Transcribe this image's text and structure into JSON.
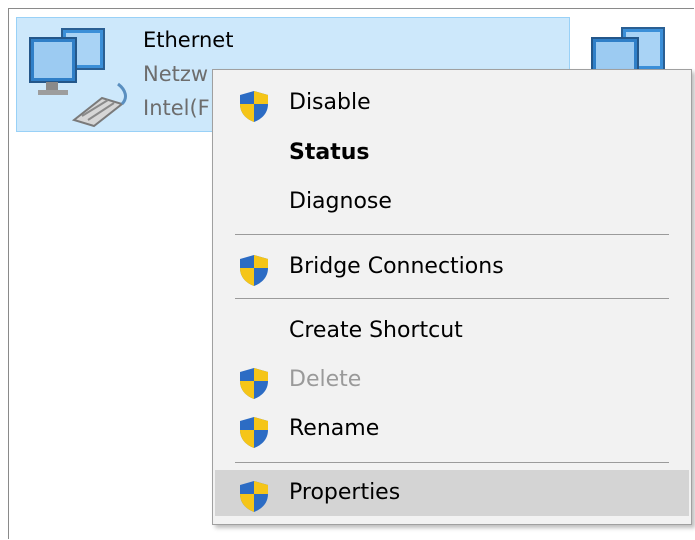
{
  "adapter": {
    "name": "Ethernet",
    "line2": "Netzw",
    "line3": "Intel(F"
  },
  "context_menu": {
    "items": [
      {
        "label": "Disable",
        "icon": "uac-shield-icon",
        "style": "normal"
      },
      {
        "label": "Status",
        "icon": "",
        "style": "bold"
      },
      {
        "label": "Diagnose",
        "icon": "",
        "style": "normal"
      },
      {
        "label": "Bridge Connections",
        "icon": "uac-shield-icon",
        "style": "normal"
      },
      {
        "label": "Create Shortcut",
        "icon": "",
        "style": "normal"
      },
      {
        "label": "Delete",
        "icon": "uac-shield-icon",
        "style": "disabled"
      },
      {
        "label": "Rename",
        "icon": "uac-shield-icon",
        "style": "normal"
      },
      {
        "label": "Properties",
        "icon": "uac-shield-icon",
        "style": "highlighted"
      }
    ]
  },
  "colors": {
    "selection_fill": "#cde8fb",
    "selection_border": "#99d1f7",
    "menu_background": "#f2f2f2",
    "menu_highlight": "#d4d4d4",
    "disabled_text": "#9a9a9a"
  }
}
